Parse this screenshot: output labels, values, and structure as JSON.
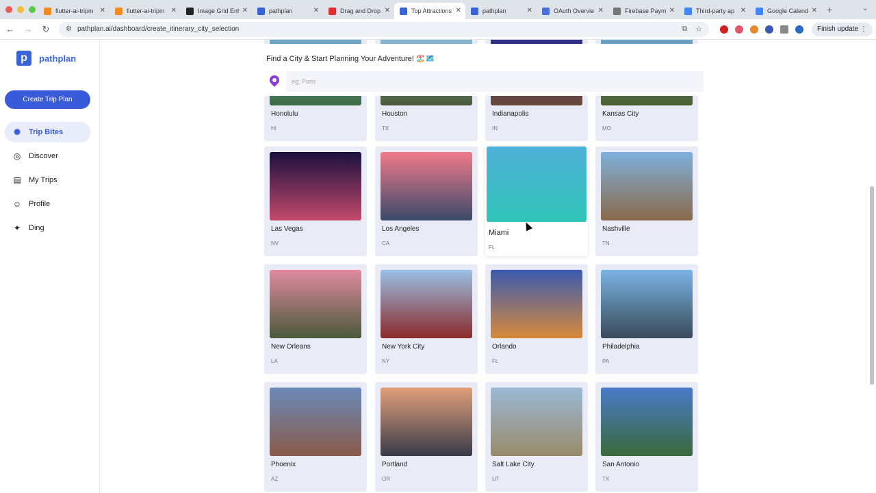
{
  "browser": {
    "tabs": [
      {
        "title": "flutter-ai-tripm",
        "fav_color": "#f08a24",
        "active": false
      },
      {
        "title": "flutter-ai-tripm",
        "fav_color": "#f08a24",
        "active": false
      },
      {
        "title": "Image Grid Enh",
        "fav_color": "#222222",
        "active": false
      },
      {
        "title": "pathplan",
        "fav_color": "#3a63d8",
        "active": false
      },
      {
        "title": "Drag and Drop",
        "fav_color": "#e03030",
        "active": false
      },
      {
        "title": "Top Attractions",
        "fav_color": "#3a63d8",
        "active": true
      },
      {
        "title": "pathplan",
        "fav_color": "#3a63d8",
        "active": false
      },
      {
        "title": "OAuth Overvie",
        "fav_color": "#4a6fd8",
        "active": false
      },
      {
        "title": "Firebase Paym",
        "fav_color": "#777777",
        "active": false
      },
      {
        "title": "Third-party ap",
        "fav_color": "#4285f4",
        "active": false
      },
      {
        "title": "Google Calend",
        "fav_color": "#4285f4",
        "active": false
      }
    ],
    "new_tab": "+",
    "url": "pathplan.ai/dashboard/create_itinerary_city_selection",
    "finish_update": "Finish update"
  },
  "sidebar": {
    "brand_letter": "p",
    "brand_name": "pathplan",
    "create_button": "Create Trip Plan",
    "items": [
      {
        "label": "Trip Bites",
        "icon": "sparkle-icon",
        "glyph": "✺",
        "active": true
      },
      {
        "label": "Discover",
        "icon": "discover-icon",
        "glyph": "◎",
        "active": false
      },
      {
        "label": "My Trips",
        "icon": "map-icon",
        "glyph": "▤",
        "active": false
      },
      {
        "label": "Profile",
        "icon": "profile-icon",
        "glyph": "☺",
        "active": false
      },
      {
        "label": "Ding",
        "icon": "notification-icon",
        "glyph": "✦",
        "active": false
      }
    ]
  },
  "search": {
    "title": "Find a City & Start Planning Your Adventure! 🏖️🗺️",
    "placeholder": "eg: Paris"
  },
  "cities": [
    {
      "name": "Honolulu",
      "state": "HI",
      "grad": [
        "#6fa8c8",
        "#3d6b45"
      ]
    },
    {
      "name": "Houston",
      "state": "TX",
      "grad": [
        "#8ab8d6",
        "#4b5a3a"
      ]
    },
    {
      "name": "Indianapolis",
      "state": "IN",
      "grad": [
        "#2a2a8a",
        "#6a4a3a"
      ]
    },
    {
      "name": "Kansas City",
      "state": "MO",
      "grad": [
        "#6fa3d0",
        "#4a5d2e"
      ]
    },
    {
      "name": "Las Vegas",
      "state": "NV",
      "grad": [
        "#1a1040",
        "#c24a6a"
      ]
    },
    {
      "name": "Los Angeles",
      "state": "CA",
      "grad": [
        "#f07a8a",
        "#3a4a6a"
      ]
    },
    {
      "name": "Miami",
      "state": "FL",
      "grad": [
        "#4fb0d8",
        "#2fc4b8"
      ]
    },
    {
      "name": "Nashville",
      "state": "TN",
      "grad": [
        "#7fb0dc",
        "#8a6a4a"
      ]
    },
    {
      "name": "New Orleans",
      "state": "LA",
      "grad": [
        "#e08aa0",
        "#4a5a3a"
      ]
    },
    {
      "name": "New York City",
      "state": "NY",
      "grad": [
        "#9ac0e6",
        "#8a2a2a"
      ]
    },
    {
      "name": "Orlando",
      "state": "FL",
      "grad": [
        "#3a5ab0",
        "#d88a3a"
      ]
    },
    {
      "name": "Philadelphia",
      "state": "PA",
      "grad": [
        "#7ab4e6",
        "#3a4a5a"
      ]
    },
    {
      "name": "Phoenix",
      "state": "AZ",
      "grad": [
        "#6a8ab8",
        "#8a5a4a"
      ]
    },
    {
      "name": "Portland",
      "state": "OR",
      "grad": [
        "#e0a07a",
        "#3a3a4a"
      ]
    },
    {
      "name": "Salt Lake City",
      "state": "UT",
      "grad": [
        "#9ab8d6",
        "#9a8a6a"
      ]
    },
    {
      "name": "San Antonio",
      "state": "TX",
      "grad": [
        "#4a7ac8",
        "#3a6a3a"
      ]
    }
  ],
  "colors": {
    "accent": "#3a5bd9",
    "card_bg": "#e9ebf6",
    "pin": "#8b3bd8"
  }
}
